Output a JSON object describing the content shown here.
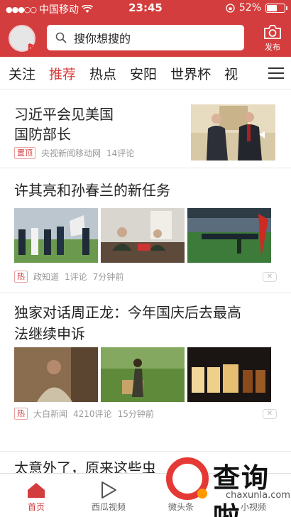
{
  "status_bar": {
    "carrier": "中国移动",
    "time": "23:45",
    "battery": "52%",
    "battery_level": 0.52
  },
  "header": {
    "search_placeholder": "搜你想搜的",
    "publish_label": "发布"
  },
  "tabs": [
    {
      "label": "关注",
      "active": false
    },
    {
      "label": "推荐",
      "active": true
    },
    {
      "label": "热点",
      "active": false
    },
    {
      "label": "安阳",
      "active": false
    },
    {
      "label": "世界杯",
      "active": false
    },
    {
      "label": "视",
      "active": false
    }
  ],
  "feed": [
    {
      "title_line1": "习近平会见美国",
      "title_line2": "国防部长",
      "tag": "置顶",
      "source": "央视新闻移动网",
      "comments": "14评论"
    },
    {
      "title": "许其亮和孙春兰的新任务",
      "tag": "热",
      "source": "政知道",
      "comments": "1评论",
      "time": "7分钟前"
    },
    {
      "title_line1": "独家对话周正龙：今年国庆后去最高",
      "title_line2": "法继续申诉",
      "tag": "热",
      "source": "大白新闻",
      "comments": "4210评论",
      "time": "15分钟前"
    },
    {
      "title": "太意外了，原来这些虫"
    }
  ],
  "bottom_nav": [
    {
      "label": "首页",
      "active": true
    },
    {
      "label": "西瓜视频",
      "active": false
    },
    {
      "label": "微头条",
      "active": false
    },
    {
      "label": "小视频",
      "active": false
    }
  ],
  "watermark": {
    "name": "查询啦",
    "domain": "chaxunla.com"
  },
  "colors": {
    "brand": "#d43d3d",
    "watermark_red": "#e53935",
    "watermark_orange": "#ff9800"
  }
}
